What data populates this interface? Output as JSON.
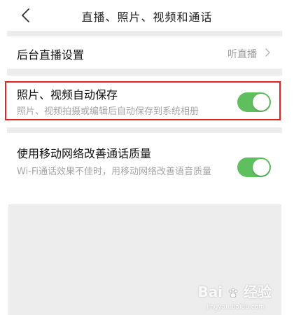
{
  "nav": {
    "title": "直播、照片、视频和通话",
    "back_icon": "chevron-left-icon"
  },
  "live_setting": {
    "title": "后台直播设置",
    "value": "听直播",
    "chevron_icon": "chevron-right-icon"
  },
  "auto_save": {
    "title": "照片、视频自动保存",
    "desc": "照片、视频拍摄或编辑后自动保存到系统相册",
    "enabled": true
  },
  "call_quality": {
    "title": "使用移动网络改善通话质量",
    "desc": "Wi-Fi通话效果不佳时，用移动网络改善语音质量",
    "enabled": true
  },
  "watermark": {
    "text_before": "Bai",
    "text_after": "经验",
    "sub": "jingyan.baidu.com",
    "icon": "paw-icon"
  },
  "colors": {
    "toggle_on": "#5fbf5e",
    "highlight": "#e02424",
    "background_gray": "#ededed"
  }
}
